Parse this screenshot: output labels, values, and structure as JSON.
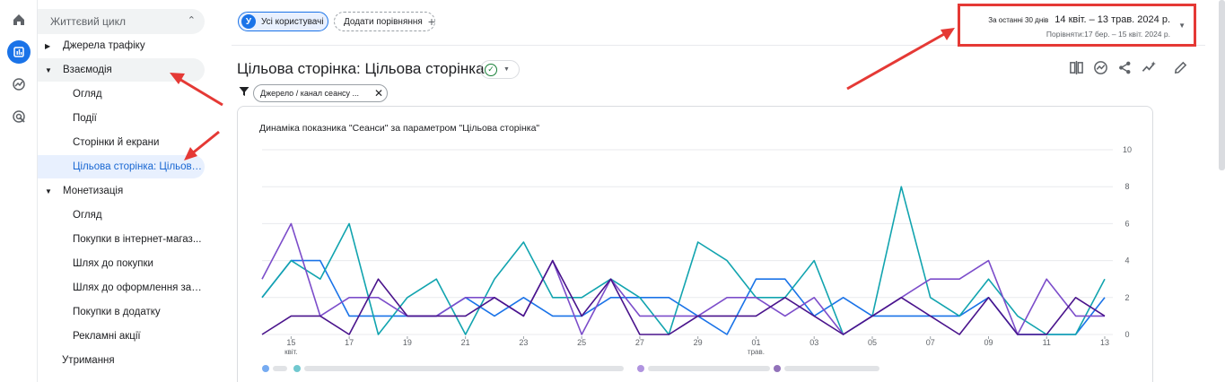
{
  "rail": {
    "icons": [
      "home-icon",
      "reports-icon",
      "explore-icon",
      "advertising-icon"
    ]
  },
  "sidebar": {
    "section": "Життєвий цикл",
    "items": [
      {
        "label": "Джерела трафіку"
      },
      {
        "label": "Взаємодія"
      },
      {
        "label": "Огляд"
      },
      {
        "label": "Події"
      },
      {
        "label": "Сторінки й екрани"
      },
      {
        "label": "Цільова сторінка: Цільова..."
      },
      {
        "label": "Монетизація"
      },
      {
        "label": "Огляд"
      },
      {
        "label": "Покупки в інтернет-магаз..."
      },
      {
        "label": "Шлях до покупки"
      },
      {
        "label": "Шлях до оформлення зам..."
      },
      {
        "label": "Покупки в додатку"
      },
      {
        "label": "Рекламні акції"
      },
      {
        "label": "Утримання"
      }
    ]
  },
  "topbar": {
    "users_avatar": "У",
    "users_label": "Усі користувачі",
    "add_comparison": "Додати порівняння",
    "date_range_label": "За останні 30 днів",
    "date_range": "14 квіт. – 13 трав. 2024 р.",
    "compare_range": "Порівняти:17 бер. – 15 квіт. 2024 р."
  },
  "page": {
    "title": "Цільова сторінка: Цільова сторінка",
    "filter": "Джерело / канал сеансу ..."
  },
  "toolbar": {
    "icons": [
      "compare-icon",
      "insights-icon",
      "share-icon",
      "trend-icon",
      "edit-icon"
    ]
  },
  "chart_data": {
    "type": "line",
    "title": "Динаміка показника \"Сеанси\" за параметром \"Цільова сторінка\"",
    "x_tick_labels": [
      "15",
      "17",
      "19",
      "21",
      "23",
      "25",
      "27",
      "29",
      "01",
      "03",
      "05",
      "07",
      "09",
      "11",
      "13"
    ],
    "x_sub_labels": {
      "15": "квіт.",
      "01": "трав."
    },
    "y_tick_labels": [
      "0",
      "2",
      "4",
      "6",
      "8",
      "10"
    ],
    "ylim": [
      0,
      10
    ],
    "grid": true,
    "y_axis_side": "right",
    "x": [
      "14",
      "15",
      "16",
      "17",
      "18",
      "19",
      "20",
      "21",
      "22",
      "23",
      "24",
      "25",
      "26",
      "27",
      "28",
      "29",
      "30",
      "01",
      "02",
      "03",
      "04",
      "05",
      "06",
      "07",
      "08",
      "09",
      "10",
      "11",
      "12",
      "13"
    ],
    "series": [
      {
        "color": "#1a73e8",
        "values": [
          2,
          4,
          4,
          1,
          1,
          1,
          1,
          2,
          1,
          2,
          1,
          1,
          2,
          2,
          2,
          1,
          0,
          3,
          3,
          1,
          2,
          1,
          1,
          1,
          1,
          2,
          0,
          0,
          0,
          2
        ]
      },
      {
        "color": "#12a4af",
        "values": [
          2,
          4,
          3,
          6,
          0,
          2,
          3,
          0,
          3,
          5,
          2,
          2,
          3,
          2,
          0,
          5,
          4,
          2,
          2,
          4,
          0,
          1,
          8,
          2,
          1,
          3,
          1,
          0,
          0,
          3
        ]
      },
      {
        "color": "#7c4dca",
        "values": [
          3,
          6,
          1,
          2,
          2,
          1,
          1,
          2,
          2,
          1,
          4,
          0,
          3,
          1,
          1,
          1,
          2,
          2,
          1,
          2,
          0,
          1,
          2,
          3,
          3,
          4,
          0,
          3,
          1,
          1
        ]
      },
      {
        "color": "#4a148c",
        "values": [
          0,
          1,
          1,
          0,
          3,
          1,
          1,
          1,
          2,
          1,
          4,
          1,
          3,
          0,
          0,
          1,
          1,
          1,
          2,
          1,
          0,
          1,
          2,
          1,
          0,
          2,
          0,
          0,
          2,
          1
        ]
      }
    ],
    "legend": {
      "placement": "bottom-left",
      "blurred": true
    }
  }
}
